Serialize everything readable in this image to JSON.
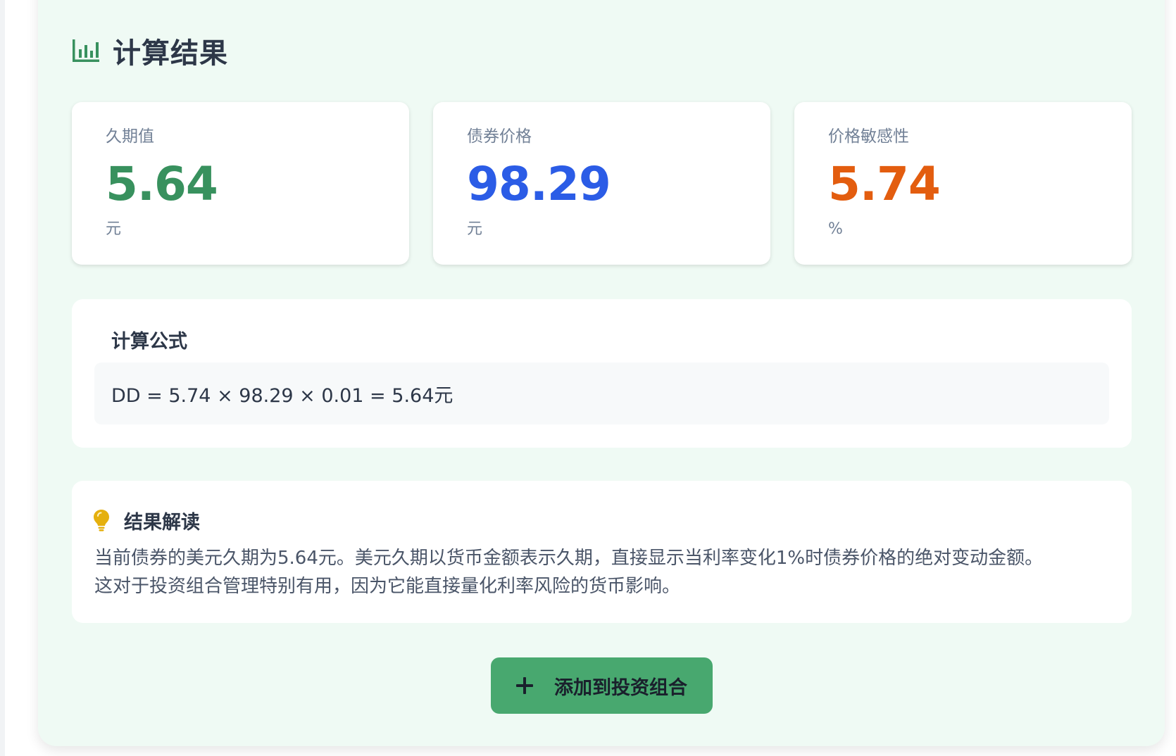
{
  "header": {
    "icon": "bar-chart-icon",
    "title": "计算结果"
  },
  "cards": [
    {
      "label": "久期值",
      "value": "5.64",
      "unit": "元",
      "color": "#38915e"
    },
    {
      "label": "债券价格",
      "value": "98.29",
      "unit": "元",
      "color": "#2b5ce6"
    },
    {
      "label": "价格敏感性",
      "value": "5.74",
      "unit": "%",
      "color": "#e35d0f"
    }
  ],
  "formula": {
    "title": "计算公式",
    "content": "DD = 5.74 × 98.29 × 0.01 = 5.64元"
  },
  "interpretation": {
    "icon": "lightbulb-icon",
    "title": "结果解读",
    "line1": "当前债券的美元久期为5.64元。美元久期以货币金额表示久期，直接显示当利率变化1%时债券价格的绝对变动金额。",
    "line2": "这对于投资组合管理特别有用，因为它能直接量化利率风险的货币影响。"
  },
  "action": {
    "icon": "plus-icon",
    "label": "添加到投资组合"
  },
  "colors": {
    "panel_bg": "#effaf4",
    "accent_green": "#48a86f",
    "bulb": "#e5b00e"
  }
}
